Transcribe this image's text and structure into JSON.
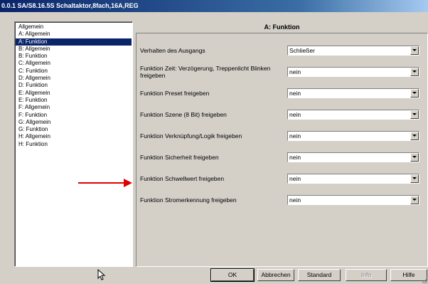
{
  "window": {
    "title": "0.0.1 SA/S8.16.5S Schaltaktor,8fach,16A,REG"
  },
  "sidebar": {
    "selected_index": 2,
    "items": [
      "Allgemein",
      "A: Allgemein",
      "A: Funktion",
      "B: Allgemein",
      "B: Funktion",
      "C: Allgemein",
      "C: Funktion",
      "D: Allgemein",
      "D: Funktion",
      "E: Allgemein",
      "E: Funktion",
      "F: Allgemein",
      "F: Funktion",
      "G: Allgemein",
      "G: Funktion",
      "H: Allgemein",
      "H: Funktion"
    ]
  },
  "content": {
    "title": "A: Funktion",
    "params": [
      {
        "label": "Verhalten des Ausgangs",
        "value": "Schließer"
      },
      {
        "label": "Funktion Zeit: Verzögerung, Treppenlicht Blinken freigeben",
        "value": "nein"
      },
      {
        "label": "Funktion Preset freigeben",
        "value": "nein"
      },
      {
        "label": "Funktion Szene (8 Bit) freigeben",
        "value": "nein"
      },
      {
        "label": "Funktion Verknüpfung/Logik freigeben",
        "value": "nein"
      },
      {
        "label": "Funktion Sicherheit freigeben",
        "value": "nein"
      },
      {
        "label": "Funktion Schwellwert freigeben",
        "value": "nein"
      },
      {
        "label": "Funktion Stromerkennung freigeben",
        "value": "nein"
      }
    ]
  },
  "buttons": {
    "ok": "OK",
    "cancel": "Abbrechen",
    "default": "Standard",
    "info": "Info",
    "help": "Hilfe"
  },
  "annotation": {
    "arrow_color": "#e00000"
  },
  "colors": {
    "title_bar": "#0a246a",
    "selection": "#0a246a",
    "face": "#d4d0c8"
  }
}
